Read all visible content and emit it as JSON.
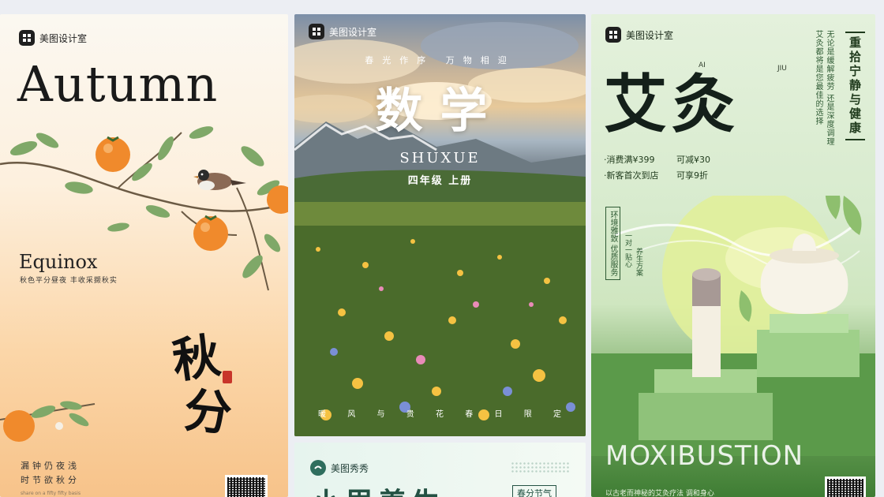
{
  "colors": {
    "page_bg": "#eceef3",
    "autumn_accent": "#f08a2c",
    "moxa_green": "#3f7d34",
    "math_sky": "#c9b59a"
  },
  "brand": {
    "name": "美图设计室",
    "icon": "meitu-logo-icon"
  },
  "cards": {
    "autumn": {
      "title": "Autumn",
      "subtitle": "Equinox",
      "subtitle_cn": "秋色平分昼夜 丰收采撷秋实",
      "calligraphy_1": "秋",
      "calligraphy_2": "分",
      "poem_line_1": "漏钟仍夜浅",
      "poem_line_2": "时节欲秋分",
      "tiny_text": "share on a fifty fifty basis"
    },
    "math": {
      "slogan": "春光作序 万物相迎",
      "title": "数学",
      "pinyin": "SHUXUE",
      "grade": "四年级 上册",
      "bottom_words": [
        "暖",
        "风",
        "与",
        "贵",
        "花",
        "春",
        "日",
        "限",
        "定"
      ]
    },
    "moxa": {
      "title": "艾灸",
      "ai_label": "AI",
      "jiu_label": "JIU",
      "vertical_box": "重拾宁静与健康",
      "vertical_text": "无论是缓解疲劳 还是深度调理 艾灸都将是您最佳的选择",
      "offer_1_a": "·消费满¥399",
      "offer_1_b": "可减¥30",
      "offer_2_a": "·新客首次到店",
      "offer_2_b": "可享9折",
      "side_label_1": "环境雅致 优质服务",
      "side_label_2": "一对一贴心",
      "side_label_3": "养生方案",
      "english": "MOXIBUSTION",
      "footer": "以古老而神秘的艾灸疗法 调和身心"
    },
    "xiuxiu": {
      "brand": "美图秀秀",
      "title": "小里养生",
      "tag": "春分节气"
    }
  }
}
